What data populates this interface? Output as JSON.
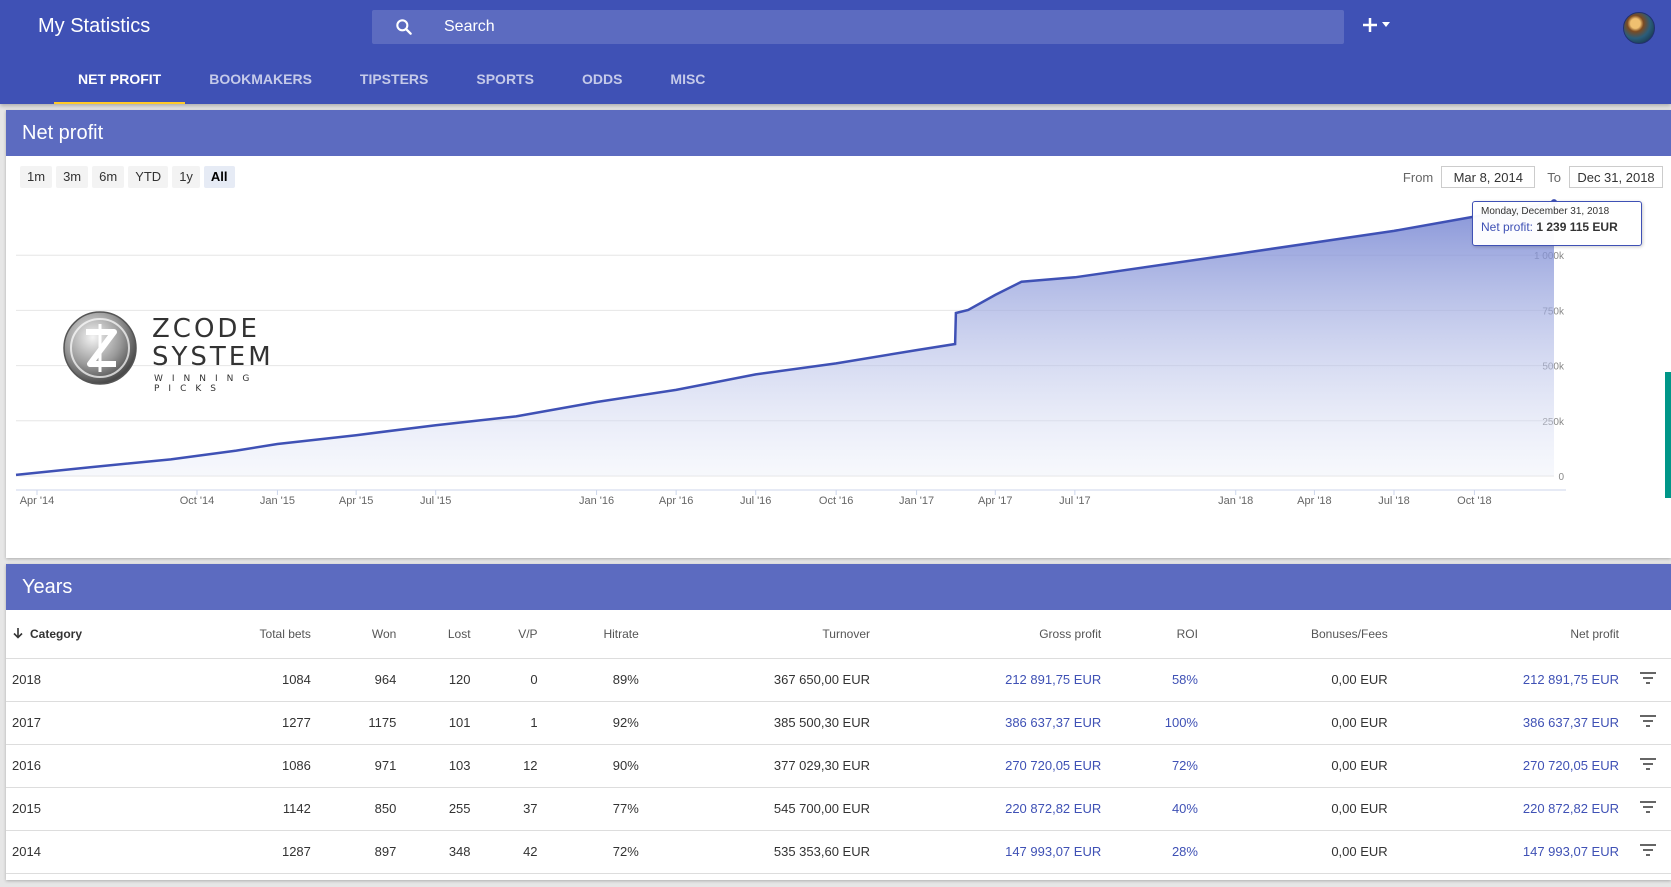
{
  "app": {
    "title": "My Statistics",
    "search_placeholder": "Search",
    "tabs": [
      "NET PROFIT",
      "BOOKMAKERS",
      "TIPSTERS",
      "SPORTS",
      "ODDS",
      "MISC"
    ],
    "active_tab": "NET PROFIT",
    "colors": {
      "primary": "#3f51b5",
      "header": "#5c6bc0",
      "accent": "#ffca28",
      "link": "#3f51b5"
    }
  },
  "chart_card": {
    "title": "Net profit",
    "ranges": [
      "1m",
      "3m",
      "6m",
      "YTD",
      "1y",
      "All"
    ],
    "active_range": "All",
    "from_label": "From",
    "from_value": "Mar 8, 2014",
    "to_label": "To",
    "to_value": "Dec 31, 2018",
    "tooltip": {
      "date": "Monday, December 31, 2018",
      "label": "Net profit:",
      "value": "1 239 115 EUR"
    },
    "watermark": {
      "line1": "ZCODE",
      "line2": "SYSTEM",
      "tagline": "WINNING PICKS",
      "badge": "Z"
    }
  },
  "chart_data": {
    "type": "area",
    "ylabel": "Net profit",
    "xlim": [
      "2014-03-08",
      "2018-12-31"
    ],
    "ylim": [
      0,
      1250000
    ],
    "y_ticks": [
      0,
      250000,
      500000,
      750000,
      1000000
    ],
    "y_tick_labels": [
      "0",
      "250k",
      "500k",
      "750k",
      "1 000k"
    ],
    "x_ticks": [
      "2014-04-01",
      "2014-10-01",
      "2015-01-01",
      "2015-04-01",
      "2015-07-01",
      "2016-01-01",
      "2016-04-01",
      "2016-07-01",
      "2016-10-01",
      "2017-01-01",
      "2017-04-01",
      "2017-07-01",
      "2018-01-01",
      "2018-04-01",
      "2018-07-01",
      "2018-10-01"
    ],
    "x_tick_labels": [
      "Apr '14",
      "Oct '14",
      "Jan '15",
      "Apr '15",
      "Jul '15",
      "Jan '16",
      "Apr '16",
      "Jul '16",
      "Oct '16",
      "Jan '17",
      "Apr '17",
      "Jul '17",
      "Jan '18",
      "Apr '18",
      "Jul '18",
      "Oct '18"
    ],
    "grid": true,
    "series": [
      {
        "name": "Net profit",
        "color": "#3f51b5",
        "points": [
          [
            "2014-03-08",
            5000
          ],
          [
            "2014-06-01",
            40000
          ],
          [
            "2014-09-01",
            75000
          ],
          [
            "2014-11-15",
            115000
          ],
          [
            "2015-01-01",
            145000
          ],
          [
            "2015-04-01",
            185000
          ],
          [
            "2015-07-01",
            230000
          ],
          [
            "2015-10-01",
            270000
          ],
          [
            "2016-01-01",
            335000
          ],
          [
            "2016-04-01",
            390000
          ],
          [
            "2016-07-01",
            460000
          ],
          [
            "2016-10-01",
            510000
          ],
          [
            "2017-01-01",
            570000
          ],
          [
            "2017-02-14",
            598000
          ],
          [
            "2017-02-15",
            738000
          ],
          [
            "2017-03-01",
            752000
          ],
          [
            "2017-04-01",
            820000
          ],
          [
            "2017-05-01",
            880000
          ],
          [
            "2017-07-01",
            900000
          ],
          [
            "2018-01-01",
            1005000
          ],
          [
            "2018-07-01",
            1110000
          ],
          [
            "2018-12-31",
            1239115
          ]
        ]
      }
    ]
  },
  "years_card": {
    "title": "Years",
    "columns": [
      "Category",
      "Total bets",
      "Won",
      "Lost",
      "V/P",
      "Hitrate",
      "Turnover",
      "Gross profit",
      "ROI",
      "Bonuses/Fees",
      "Net profit"
    ],
    "rows": [
      [
        "2018",
        "1084",
        "964",
        "120",
        "0",
        "89%",
        "367 650,00 EUR",
        "212 891,75 EUR",
        "58%",
        "0,00 EUR",
        "212 891,75 EUR"
      ],
      [
        "2017",
        "1277",
        "1175",
        "101",
        "1",
        "92%",
        "385 500,30 EUR",
        "386 637,37 EUR",
        "100%",
        "0,00 EUR",
        "386 637,37 EUR"
      ],
      [
        "2016",
        "1086",
        "971",
        "103",
        "12",
        "90%",
        "377 029,30 EUR",
        "270 720,05 EUR",
        "72%",
        "0,00 EUR",
        "270 720,05 EUR"
      ],
      [
        "2015",
        "1142",
        "850",
        "255",
        "37",
        "77%",
        "545 700,00 EUR",
        "220 872,82 EUR",
        "40%",
        "0,00 EUR",
        "220 872,82 EUR"
      ],
      [
        "2014",
        "1287",
        "897",
        "348",
        "42",
        "72%",
        "535 353,60 EUR",
        "147 993,07 EUR",
        "28%",
        "0,00 EUR",
        "147 993,07 EUR"
      ]
    ]
  }
}
